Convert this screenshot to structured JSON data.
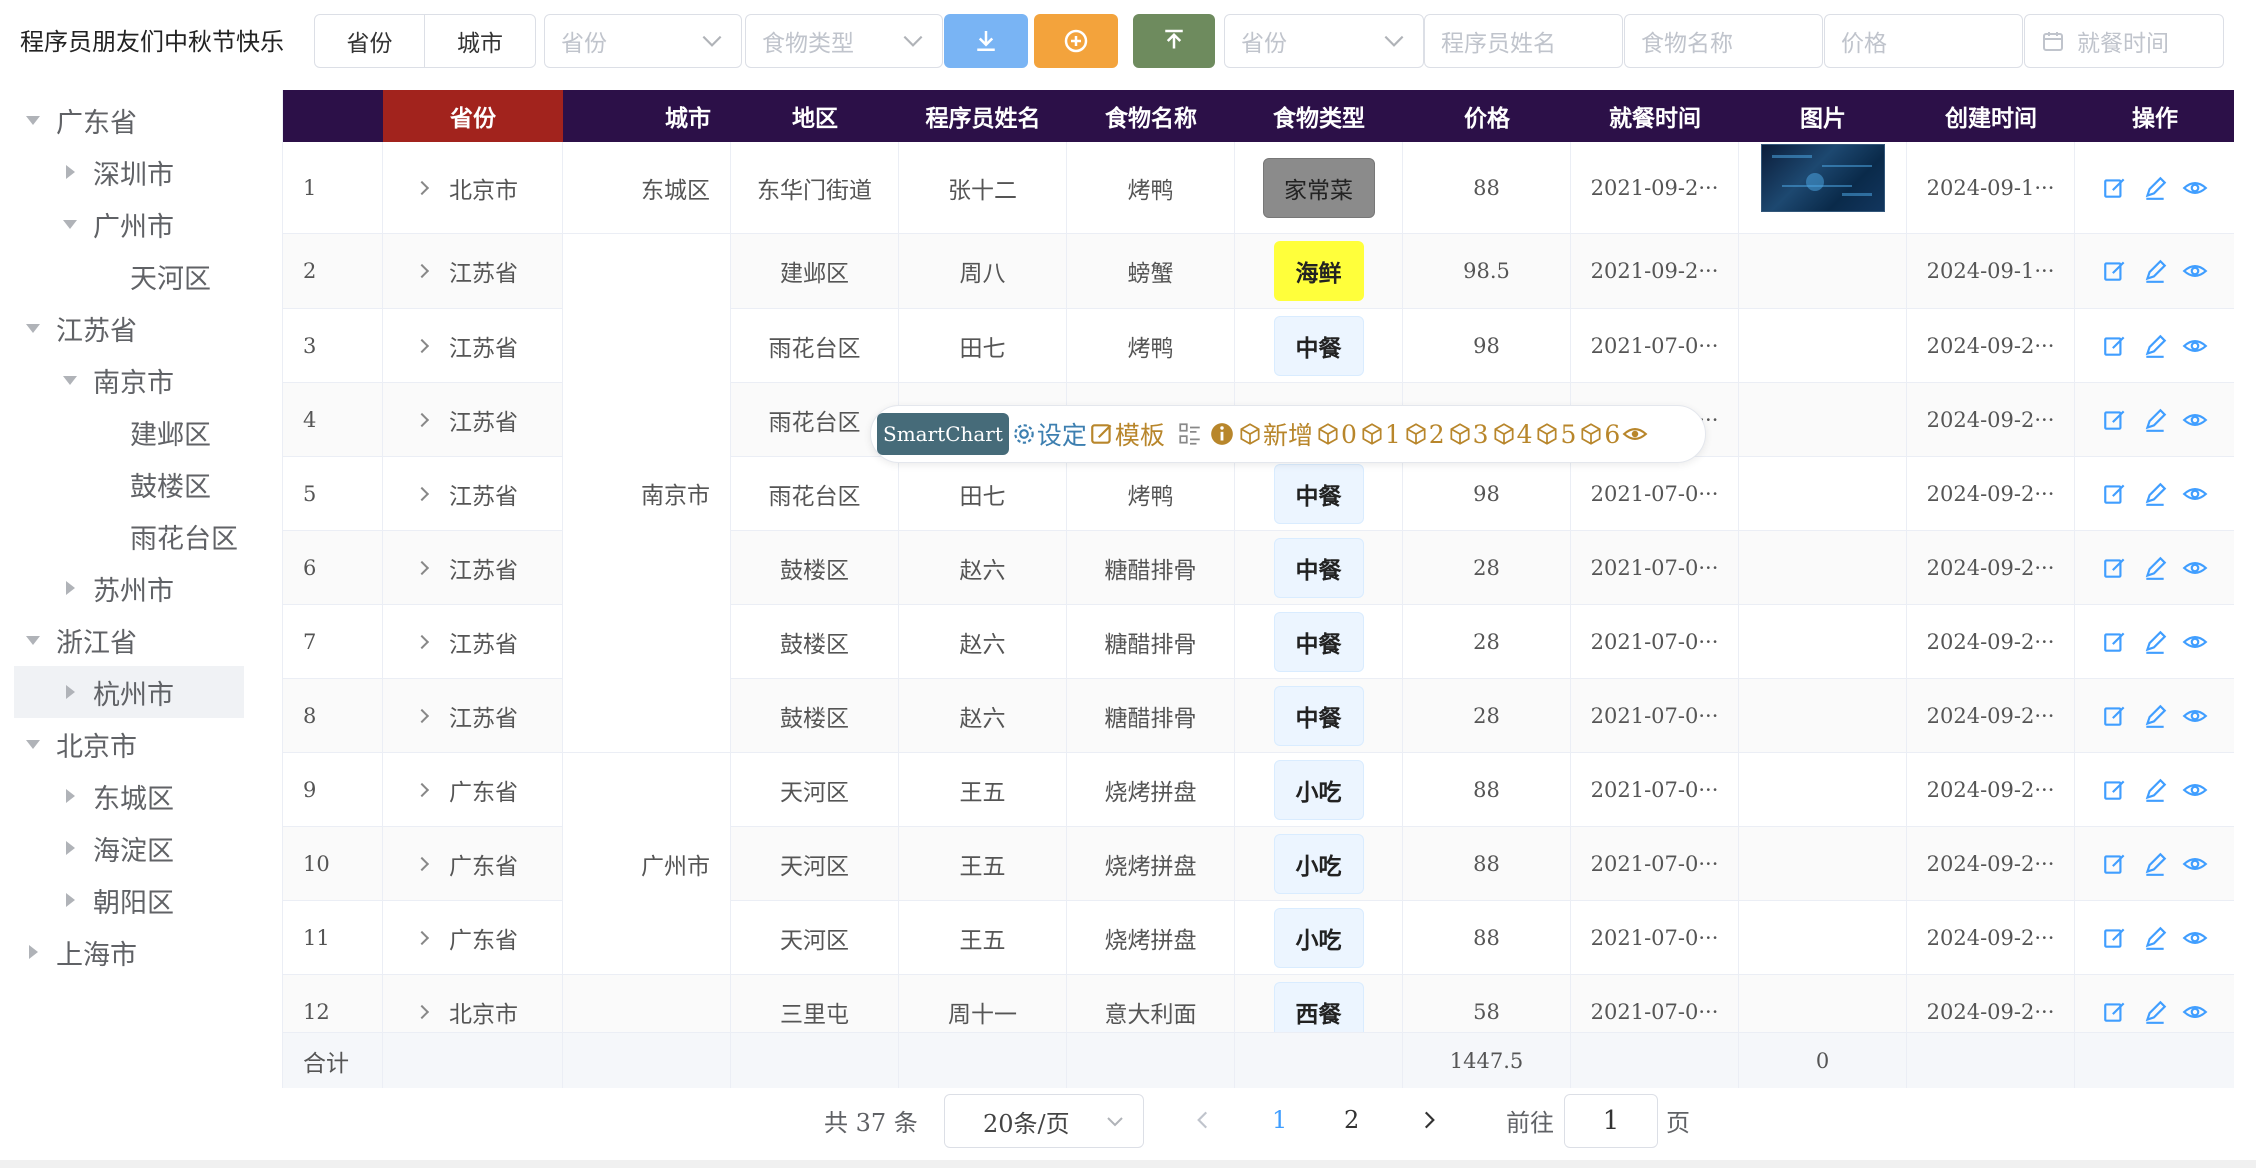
{
  "app": {
    "title": "程序员朋友们中秋节快乐"
  },
  "toolbar": {
    "segment": [
      "省份",
      "城市"
    ],
    "filter_province_placeholder": "省份",
    "filter_food_type_placeholder": "食物类型",
    "filter_province2_placeholder": "省份",
    "filter_programmer_placeholder": "程序员姓名",
    "filter_food_name_placeholder": "食物名称",
    "filter_price_placeholder": "价格",
    "filter_date_placeholder": "就餐时间",
    "colors": {
      "download": "#79b4f4",
      "add": "#f3a33c",
      "upload": "#6e8b5e"
    }
  },
  "tree": [
    {
      "label": "广东省",
      "level": 0,
      "caret": "down"
    },
    {
      "label": "深圳市",
      "level": 1,
      "caret": "right"
    },
    {
      "label": "广州市",
      "level": 1,
      "caret": "down"
    },
    {
      "label": "天河区",
      "level": 2,
      "caret": "none"
    },
    {
      "label": "江苏省",
      "level": 0,
      "caret": "down"
    },
    {
      "label": "南京市",
      "level": 1,
      "caret": "down"
    },
    {
      "label": "建邺区",
      "level": 2,
      "caret": "none"
    },
    {
      "label": "鼓楼区",
      "level": 2,
      "caret": "none"
    },
    {
      "label": "雨花台区",
      "level": 2,
      "caret": "none"
    },
    {
      "label": "苏州市",
      "level": 1,
      "caret": "right"
    },
    {
      "label": "浙江省",
      "level": 0,
      "caret": "down"
    },
    {
      "label": "杭州市",
      "level": 1,
      "caret": "right",
      "active": true
    },
    {
      "label": "北京市",
      "level": 0,
      "caret": "down"
    },
    {
      "label": "东城区",
      "level": 1,
      "caret": "right"
    },
    {
      "label": "海淀区",
      "level": 1,
      "caret": "right"
    },
    {
      "label": "朝阳区",
      "level": 1,
      "caret": "right"
    },
    {
      "label": "上海市",
      "level": 0,
      "caret": "right"
    }
  ],
  "table": {
    "headers": [
      "",
      "省份",
      "城市",
      "地区",
      "程序员姓名",
      "食物名称",
      "食物类型",
      "价格",
      "就餐时间",
      "图片",
      "创建时间",
      "操作"
    ],
    "rows": [
      {
        "idx": "1",
        "province": "北京市",
        "district": "东华门街道",
        "name": "张十二",
        "food": "烤鸭",
        "type": "家常菜",
        "price": "88",
        "date": "2021-09-2···",
        "created": "2024-09-1···"
      },
      {
        "idx": "2",
        "province": "江苏省",
        "district": "建邺区",
        "name": "周八",
        "food": "螃蟹",
        "type": "海鲜",
        "price": "98.5",
        "date": "2021-09-2···",
        "created": "2024-09-1···"
      },
      {
        "idx": "3",
        "province": "江苏省",
        "district": "雨花台区",
        "name": "田七",
        "food": "烤鸭",
        "type": "中餐",
        "price": "98",
        "date": "2021-07-0···",
        "created": "2024-09-2···"
      },
      {
        "idx": "4",
        "province": "江苏省",
        "district": "雨花台区",
        "name": "",
        "food": "",
        "type": "",
        "price": "",
        "date": "2021-07-0···",
        "created": "2024-09-2···"
      },
      {
        "idx": "5",
        "province": "江苏省",
        "district": "雨花台区",
        "name": "田七",
        "food": "烤鸭",
        "type": "中餐",
        "price": "98",
        "date": "2021-07-0···",
        "created": "2024-09-2···"
      },
      {
        "idx": "6",
        "province": "江苏省",
        "district": "鼓楼区",
        "name": "赵六",
        "food": "糖醋排骨",
        "type": "中餐",
        "price": "28",
        "date": "2021-07-0···",
        "created": "2024-09-2···"
      },
      {
        "idx": "7",
        "province": "江苏省",
        "district": "鼓楼区",
        "name": "赵六",
        "food": "糖醋排骨",
        "type": "中餐",
        "price": "28",
        "date": "2021-07-0···",
        "created": "2024-09-2···"
      },
      {
        "idx": "8",
        "province": "江苏省",
        "district": "鼓楼区",
        "name": "赵六",
        "food": "糖醋排骨",
        "type": "中餐",
        "price": "28",
        "date": "2021-07-0···",
        "created": "2024-09-2···"
      },
      {
        "idx": "9",
        "province": "广东省",
        "district": "天河区",
        "name": "王五",
        "food": "烧烤拼盘",
        "type": "小吃",
        "price": "88",
        "date": "2021-07-0···",
        "created": "2024-09-2···"
      },
      {
        "idx": "10",
        "province": "广东省",
        "district": "天河区",
        "name": "王五",
        "food": "烧烤拼盘",
        "type": "小吃",
        "price": "88",
        "date": "2021-07-0···",
        "created": "2024-09-2···"
      },
      {
        "idx": "11",
        "province": "广东省",
        "district": "天河区",
        "name": "王五",
        "food": "烧烤拼盘",
        "type": "小吃",
        "price": "88",
        "date": "2021-07-0···",
        "created": "2024-09-2···"
      },
      {
        "idx": "12",
        "province": "北京市",
        "district": "三里屯",
        "name": "周十一",
        "food": "意大利面",
        "type": "西餐",
        "price": "58",
        "date": "2021-07-0···",
        "created": "2024-09-2···"
      }
    ],
    "merged_cities": [
      {
        "label": "东城区",
        "rows": [
          0,
          0
        ]
      },
      {
        "label": "南京市",
        "rows": [
          1,
          7
        ]
      },
      {
        "label": "广州市",
        "rows": [
          8,
          10
        ]
      }
    ],
    "type_colors": {
      "家常菜": "#8b8b8b",
      "海鲜": "#ffff3b",
      "中餐": "#ecf5ff",
      "小吃": "#ecf5ff",
      "西餐": "#ecf5ff"
    },
    "total": {
      "label": "合计",
      "price": "1447.5",
      "image": "0"
    }
  },
  "smartchart": {
    "brand": "SmartChart",
    "items": [
      "设定",
      "模板",
      "",
      "",
      "新增",
      "0",
      "1",
      "2",
      "3",
      "4",
      "5",
      "6",
      ""
    ]
  },
  "pagination": {
    "total_text": "共 37 条",
    "page_size": "20条/页",
    "pages": [
      "1",
      "2"
    ],
    "current": "1",
    "goto_label": "前往",
    "goto_value": "1",
    "goto_unit": "页"
  }
}
